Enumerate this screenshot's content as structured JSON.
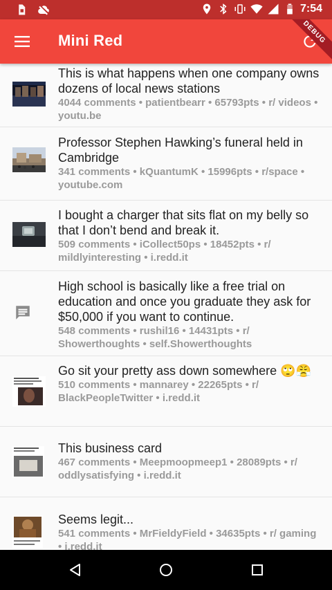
{
  "status_bar": {
    "time": "7:54"
  },
  "app_bar": {
    "title": "Mini Red",
    "debug_label": "DEBUG"
  },
  "posts": [
    {
      "title": "This is what happens when one company owns dozens of local news stations",
      "meta": "4044 comments • patientbearr • 65793pts • r/ videos • youtu.be",
      "thumb": "news-thumbnail"
    },
    {
      "title": "Professor Stephen Hawking’s funeral held in Cambridge",
      "meta": "341 comments • kQuantumK • 15996pts • r/space • youtube.com",
      "thumb": "cambridge-thumbnail"
    },
    {
      "title": "I bought a charger that sits flat on my belly so that I don’t bend and break it.",
      "meta": "509 comments • iCollect50ps • 18452pts • r/ mildlyinteresting • i.redd.it",
      "thumb": "charger-thumbnail"
    },
    {
      "title": "High school is basically like a free trial on education and once you graduate they ask for $50,000 if you want to continue.",
      "meta": "548 comments • rushil16 • 14431pts • r/ Showerthoughts • self.Showerthoughts",
      "thumb": "comment-icon"
    },
    {
      "title": "Go sit your pretty ass down somewhere 🙄😤",
      "meta": "510 comments • mannarey • 22265pts • r/ BlackPeopleTwitter • i.redd.it",
      "thumb": "tweet-thumbnail"
    },
    {
      "title": "This business card",
      "meta": "467 comments • Meepmoopmeep1 • 28089pts • r/ oddlysatisfying • i.redd.it",
      "thumb": "card-thumbnail"
    },
    {
      "title": "Seems legit...",
      "meta": "541 comments • MrFieldyField • 34635pts • r/ gaming • i.redd.it",
      "thumb": "game-thumbnail"
    }
  ]
}
